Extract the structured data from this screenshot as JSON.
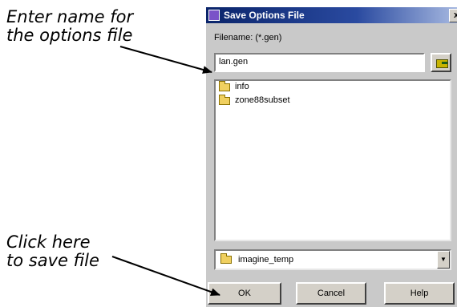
{
  "annotations": {
    "top": [
      "Enter name for",
      "the options file"
    ],
    "bottom": [
      "Click here",
      "to save file"
    ]
  },
  "dialog": {
    "title": "Save Options File",
    "close_glyph": "x",
    "filename_label": "Filename: (*.gen)",
    "filename_value": "lan.gen",
    "browse_icon": "browse-folder-icon",
    "files": [
      {
        "name": "info",
        "icon": "folder-icon"
      },
      {
        "name": "zone88subset",
        "icon": "folder-icon"
      }
    ],
    "directory": "imagine_temp",
    "dropdown_glyph": "▼",
    "buttons": {
      "ok": "OK",
      "cancel": "Cancel",
      "help": "Help"
    }
  },
  "colors": {
    "titlebar": "#0a246a",
    "dialog_bg": "#c9c9c9",
    "folder": "#f0d060"
  }
}
